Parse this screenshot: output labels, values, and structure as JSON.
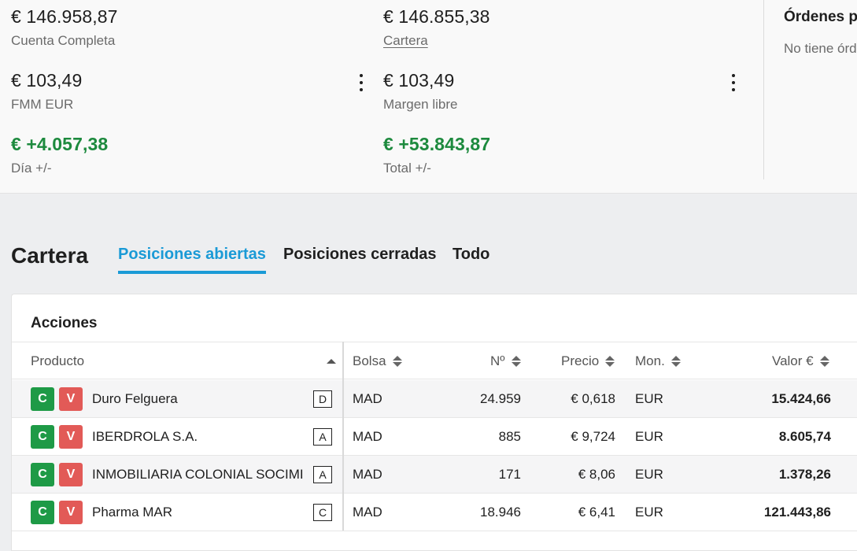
{
  "summary": {
    "cuenta_completa": {
      "value": "€ 146.958,87",
      "label": "Cuenta Completa"
    },
    "cartera": {
      "value": "€ 146.855,38",
      "label": "Cartera"
    },
    "fmm": {
      "value": "€ 103,49",
      "label": "FMM EUR"
    },
    "margen": {
      "value": "€ 103,49",
      "label": "Margen libre"
    },
    "dia": {
      "value": "€ +4.057,38",
      "label": "Día +/-"
    },
    "total": {
      "value": "€ +53.843,87",
      "label": "Total +/-"
    }
  },
  "orders": {
    "title": "Órdenes p",
    "empty": "No tiene órd"
  },
  "portfolio": {
    "title": "Cartera",
    "tabs": [
      {
        "label": "Posiciones abiertas",
        "active": true
      },
      {
        "label": "Posiciones cerradas",
        "active": false
      },
      {
        "label": "Todo",
        "active": false
      }
    ]
  },
  "table": {
    "title": "Acciones",
    "headers": {
      "producto": "Producto",
      "bolsa": "Bolsa",
      "numero": "Nº",
      "precio": "Precio",
      "moneda": "Mon.",
      "valor": "Valor €"
    },
    "buy_label": "C",
    "sell_label": "V",
    "rows": [
      {
        "producto": "Duro Felguera",
        "badge": "D",
        "bolsa": "MAD",
        "numero": "24.959",
        "precio": "€ 0,618",
        "moneda": "EUR",
        "valor": "15.424,66"
      },
      {
        "producto": "IBERDROLA S.A.",
        "badge": "A",
        "bolsa": "MAD",
        "numero": "885",
        "precio": "€ 9,724",
        "moneda": "EUR",
        "valor": "8.605,74"
      },
      {
        "producto": "INMOBILIARIA COLONIAL SOCIMI",
        "badge": "A",
        "bolsa": "MAD",
        "numero": "171",
        "precio": "€ 8,06",
        "moneda": "EUR",
        "valor": "1.378,26"
      },
      {
        "producto": "Pharma MAR",
        "badge": "C",
        "bolsa": "MAD",
        "numero": "18.946",
        "precio": "€ 6,41",
        "moneda": "EUR",
        "valor": "121.443,86"
      }
    ]
  },
  "colors": {
    "accent": "#1a9ad6",
    "positive": "#1d8a3e",
    "buy": "#1e9a46",
    "sell": "#e25a57"
  }
}
